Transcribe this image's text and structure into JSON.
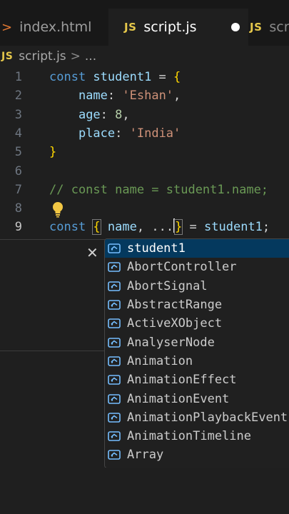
{
  "tabs": [
    {
      "label": "index.html",
      "icon": "html-chevron-icon"
    },
    {
      "label": "script.js",
      "icon": "js-icon",
      "badge": "JS",
      "unsaved": true
    },
    {
      "label": "scri",
      "icon": "js-icon",
      "badge": "JS"
    }
  ],
  "breadcrumb": {
    "badge": "JS",
    "file": "script.js",
    "sep": ">",
    "more": "..."
  },
  "editor": {
    "lines": [
      {
        "n": "1",
        "tokens": [
          {
            "t": "const ",
            "c": "kw"
          },
          {
            "t": "student1",
            "c": "var"
          },
          {
            "t": " = "
          },
          {
            "t": "{",
            "c": "br"
          }
        ]
      },
      {
        "n": "2",
        "tokens": [
          {
            "t": "    "
          },
          {
            "t": "name",
            "c": "var"
          },
          {
            "t": ": "
          },
          {
            "t": "'Eshan'",
            "c": "str"
          },
          {
            "t": ","
          }
        ]
      },
      {
        "n": "3",
        "tokens": [
          {
            "t": "    "
          },
          {
            "t": "age",
            "c": "var"
          },
          {
            "t": ": "
          },
          {
            "t": "8",
            "c": "num"
          },
          {
            "t": ","
          }
        ]
      },
      {
        "n": "4",
        "tokens": [
          {
            "t": "    "
          },
          {
            "t": "place",
            "c": "var"
          },
          {
            "t": ": "
          },
          {
            "t": "'India'",
            "c": "str"
          }
        ]
      },
      {
        "n": "5",
        "tokens": [
          {
            "t": "}",
            "c": "br"
          }
        ]
      },
      {
        "n": "6",
        "tokens": []
      },
      {
        "n": "7",
        "tokens": [
          {
            "t": "// const name = student1.name;",
            "c": "cmt"
          }
        ]
      },
      {
        "n": "8",
        "tokens": []
      },
      {
        "n": "9",
        "tokens": [
          {
            "t": "const ",
            "c": "kw"
          },
          {
            "t": "{",
            "c": "br bracehl"
          },
          {
            "t": " "
          },
          {
            "t": "name",
            "c": "var"
          },
          {
            "t": ", ..."
          },
          {
            "t": "|CURSOR|"
          },
          {
            "t": "}",
            "c": "br bracehl"
          },
          {
            "t": " = "
          },
          {
            "t": "student1",
            "c": "var"
          },
          {
            "t": ";"
          }
        ]
      }
    ],
    "active_line": "9"
  },
  "suggestions": {
    "selected_index": 0,
    "items": [
      "student1",
      "AbortController",
      "AbortSignal",
      "AbstractRange",
      "ActiveXObject",
      "AnalyserNode",
      "Animation",
      "AnimationEffect",
      "AnimationEvent",
      "AnimationPlaybackEvent",
      "AnimationTimeline",
      "Array"
    ],
    "item_icon": "variable-icon"
  },
  "colors": {
    "selection": "#04395e",
    "keyword": "#569cd6",
    "string": "#ce9178",
    "comment": "#6a9955",
    "bracket": "#ffd700",
    "js_badge": "#e6c84b"
  }
}
